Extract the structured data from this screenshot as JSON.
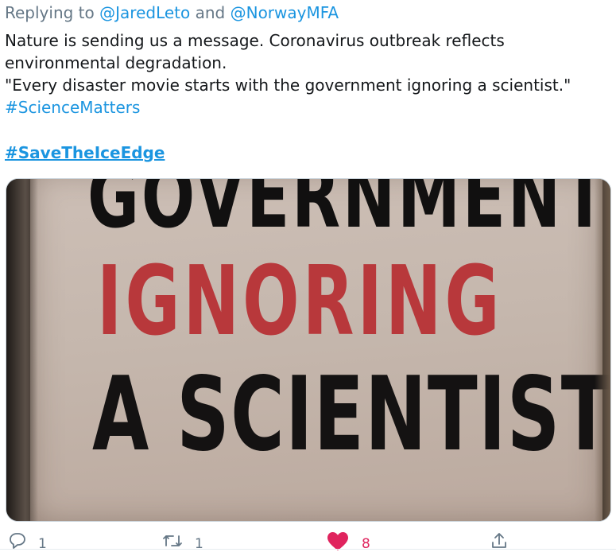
{
  "reply": {
    "prefix": "Replying to",
    "user1": "@JaredLeto",
    "conjunction": "and",
    "user2": "@NorwayMFA"
  },
  "tweet": {
    "line1": "Nature is sending us a message. Coronavirus outbreak reflects",
    "line2": "environmental degradation.",
    "line3": "\"Every disaster movie starts with the government ignoring a scientist.\"",
    "hashtag1": "#ScienceMatters",
    "hashtag2": "#SaveTheIceEdge"
  },
  "media": {
    "sign_line1": "GOVERNMENT",
    "sign_line2": "IGNORING",
    "sign_line3": "A SCIENTIST"
  },
  "actions": {
    "reply_count": "1",
    "retweet_count": "1",
    "like_count": "8",
    "reply_icon": "reply-icon",
    "retweet_icon": "retweet-icon",
    "like_icon": "heart-icon",
    "share_icon": "share-icon"
  },
  "colors": {
    "link": "#1b95e0",
    "muted": "#657786",
    "like": "#e0245e"
  }
}
